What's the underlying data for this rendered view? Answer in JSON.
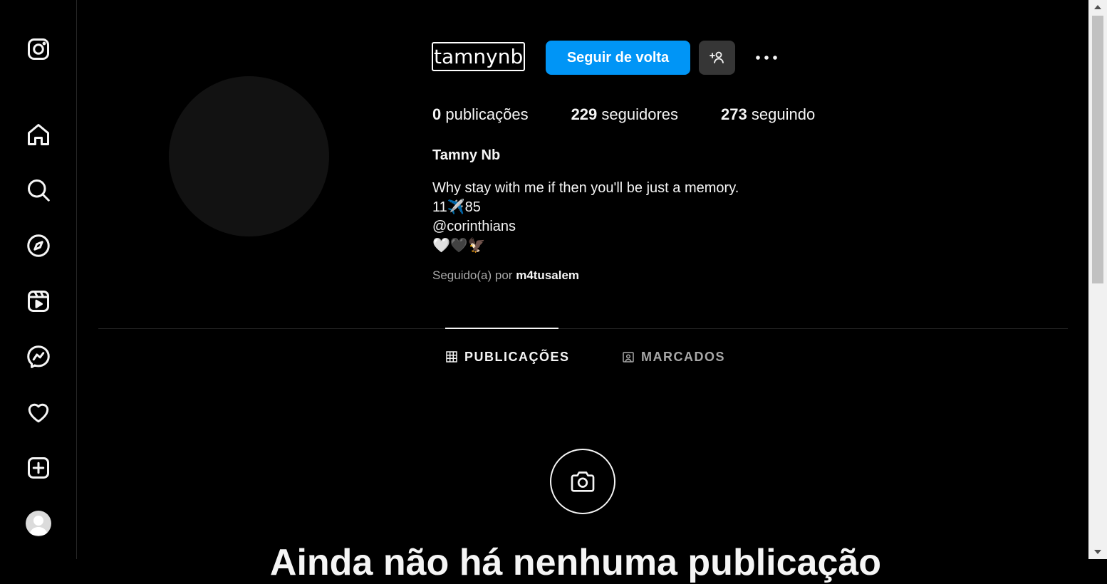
{
  "sidebar": {
    "items": [
      {
        "name": "instagram-logo-icon"
      },
      {
        "name": "home-icon"
      },
      {
        "name": "search-icon"
      },
      {
        "name": "explore-compass-icon"
      },
      {
        "name": "reels-icon"
      },
      {
        "name": "messenger-icon"
      },
      {
        "name": "notifications-heart-icon"
      },
      {
        "name": "create-plus-icon"
      },
      {
        "name": "profile-avatar"
      }
    ]
  },
  "profile": {
    "username": "tamnynb",
    "follow_back_label": "Seguir de volta",
    "stats": {
      "posts_count": "0",
      "posts_label": "publicações",
      "followers_count": "229",
      "followers_label": "seguidores",
      "following_count": "273",
      "following_label": "seguindo"
    },
    "full_name": "Tamny Nb",
    "bio_lines": [
      "Why stay with me if then you'll be just a memory.",
      "11✈️85",
      "@corinthians",
      "🤍🖤🦅"
    ],
    "followed_by_prefix": "Seguido(a) por",
    "followed_by_user": "m4tusalem"
  },
  "tabs": {
    "posts_label": "PUBLICAÇÕES",
    "tagged_label": "MARCADOS"
  },
  "empty_state": {
    "title": "Ainda não há nenhuma publicação"
  },
  "colors": {
    "accent": "#0095f6",
    "background": "#000000",
    "secondary_button": "#363636"
  }
}
